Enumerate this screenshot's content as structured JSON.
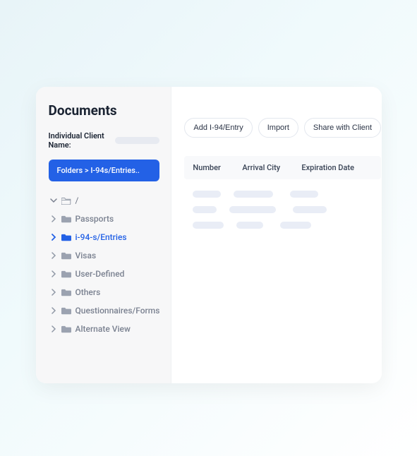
{
  "page": {
    "title": "Documents"
  },
  "client": {
    "label": "Individual Client Name:"
  },
  "breadcrumb": {
    "text": "Folders > I-94s/Entries.."
  },
  "tree": {
    "root": {
      "label": "/"
    },
    "items": [
      {
        "label": "Passports"
      },
      {
        "label": "i-94-s/Entries"
      },
      {
        "label": "Visas"
      },
      {
        "label": "User-Defined"
      },
      {
        "label": "Others"
      },
      {
        "label": "Questionnaires/Forms"
      },
      {
        "label": "Alternate View"
      }
    ]
  },
  "actions": {
    "add": "Add I-94/Entry",
    "import": "Import",
    "share": "Share with Client"
  },
  "table": {
    "headers": {
      "number": "Number",
      "arrival_city": "Arrival City",
      "expiration_date": "Expiration Date"
    }
  }
}
